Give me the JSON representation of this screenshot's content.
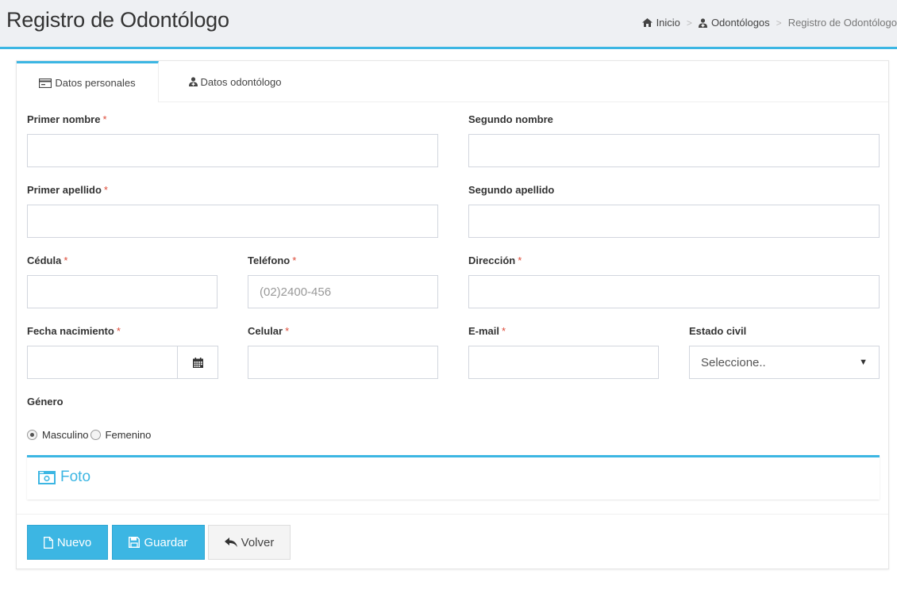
{
  "header": {
    "title": "Registro de Odontólogo",
    "breadcrumb": {
      "home": "Inicio",
      "section": "Odontólogos",
      "current": "Registro de Odontólogo",
      "separator": ">"
    }
  },
  "tabs": [
    {
      "label": "Datos personales",
      "icon": "id-card-icon",
      "active": true
    },
    {
      "label": "Datos odontólogo",
      "icon": "user-md-icon",
      "active": false
    }
  ],
  "form": {
    "required_marker": "*",
    "primer_nombre": {
      "label": "Primer nombre",
      "value": ""
    },
    "segundo_nombre": {
      "label": "Segundo nombre",
      "value": ""
    },
    "primer_apellido": {
      "label": "Primer apellido",
      "value": ""
    },
    "segundo_apellido": {
      "label": "Segundo apellido",
      "value": ""
    },
    "cedula": {
      "label": "Cédula",
      "value": ""
    },
    "telefono": {
      "label": "Teléfono",
      "placeholder": "(02)2400-456"
    },
    "direccion": {
      "label": "Dirección",
      "value": ""
    },
    "fecha_nacimiento": {
      "label": "Fecha nacimiento",
      "value": ""
    },
    "celular": {
      "label": "Celular",
      "value": ""
    },
    "email": {
      "label": "E-mail",
      "value": ""
    },
    "estado_civil": {
      "label": "Estado civil",
      "selected": "Seleccione.."
    },
    "genero": {
      "label": "Género",
      "options": [
        {
          "label": "Masculino",
          "checked": true
        },
        {
          "label": "Femenino",
          "checked": false
        }
      ]
    }
  },
  "foto": {
    "title": "Foto",
    "icon": "camera-icon"
  },
  "buttons": {
    "nuevo": "Nuevo",
    "guardar": "Guardar",
    "volver": "Volver"
  },
  "colors": {
    "accent": "#3cb6e3",
    "required": "#dd4b39",
    "header_bg": "#eef0f3"
  }
}
